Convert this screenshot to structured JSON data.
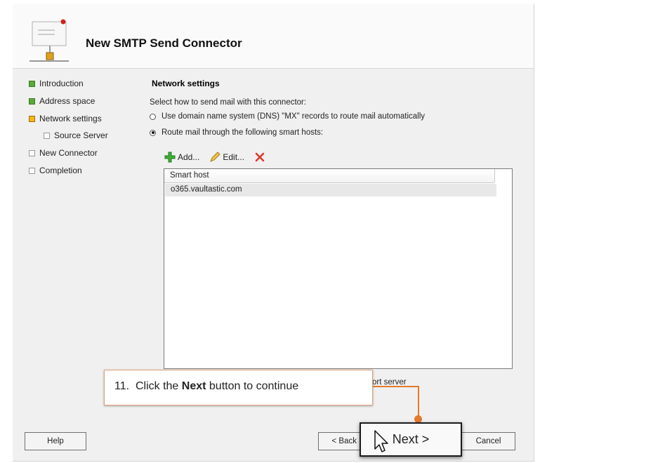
{
  "window": {
    "title": "New SMTP Send Connector"
  },
  "steps": [
    {
      "label": "Introduction",
      "state": "done"
    },
    {
      "label": "Address space",
      "state": "done"
    },
    {
      "label": "Network settings",
      "state": "current"
    },
    {
      "label": "Source Server",
      "state": "pending"
    },
    {
      "label": "New Connector",
      "state": "pending"
    },
    {
      "label": "Completion",
      "state": "pending"
    }
  ],
  "network": {
    "section_title": "Network settings",
    "prompt": "Select how to send mail with this connector:",
    "options": [
      {
        "label": "Use domain name system (DNS) \"MX\" records to route mail automatically",
        "selected": false
      },
      {
        "label": "Route mail through the following smart hosts:",
        "selected": true
      }
    ],
    "toolbar": {
      "add": "Add...",
      "edit": "Edit..."
    },
    "table": {
      "column": "Smart host",
      "rows": [
        "o365.vaultastic.com"
      ]
    },
    "partial_text": "ort server"
  },
  "callout": {
    "step": "11.",
    "text_before": "Click the",
    "bold": "Next",
    "text_after": "button to continue"
  },
  "buttons": {
    "help": "Help",
    "back": "< Back",
    "next": "Next >",
    "cancel": "Cancel"
  },
  "colors": {
    "done": "#5aa83a",
    "current": "#f3b61f",
    "callout_accent": "#e37a2c"
  }
}
